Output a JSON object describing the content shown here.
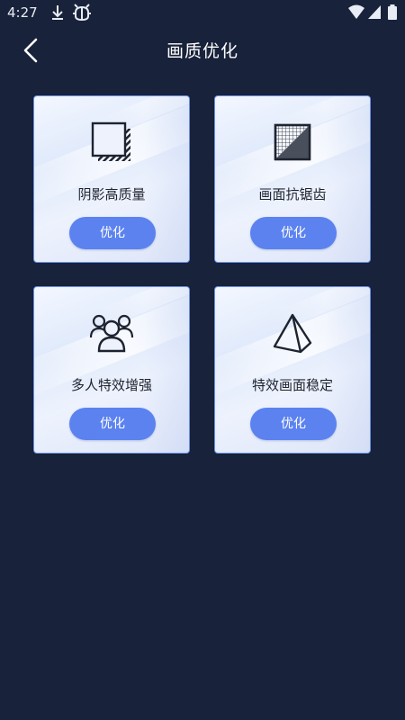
{
  "status_bar": {
    "time": "4:27",
    "icons": [
      "download-icon",
      "bug-icon",
      "wifi-icon",
      "signal-icon",
      "battery-icon"
    ]
  },
  "header": {
    "title": "画质优化",
    "back_icon": "chevron-left-icon"
  },
  "cards": [
    {
      "label": "阴影高质量",
      "icon": "shadow-square-icon",
      "button_label": "优化"
    },
    {
      "label": "画面抗锯齿",
      "icon": "antialias-grid-icon",
      "button_label": "优化"
    },
    {
      "label": "多人特效增强",
      "icon": "group-users-icon",
      "button_label": "优化"
    },
    {
      "label": "特效画面稳定",
      "icon": "pyramid-icon",
      "button_label": "优化"
    }
  ],
  "colors": {
    "background": "#18223a",
    "button": "#5b82ef",
    "card_border": "#6b8fe6"
  }
}
